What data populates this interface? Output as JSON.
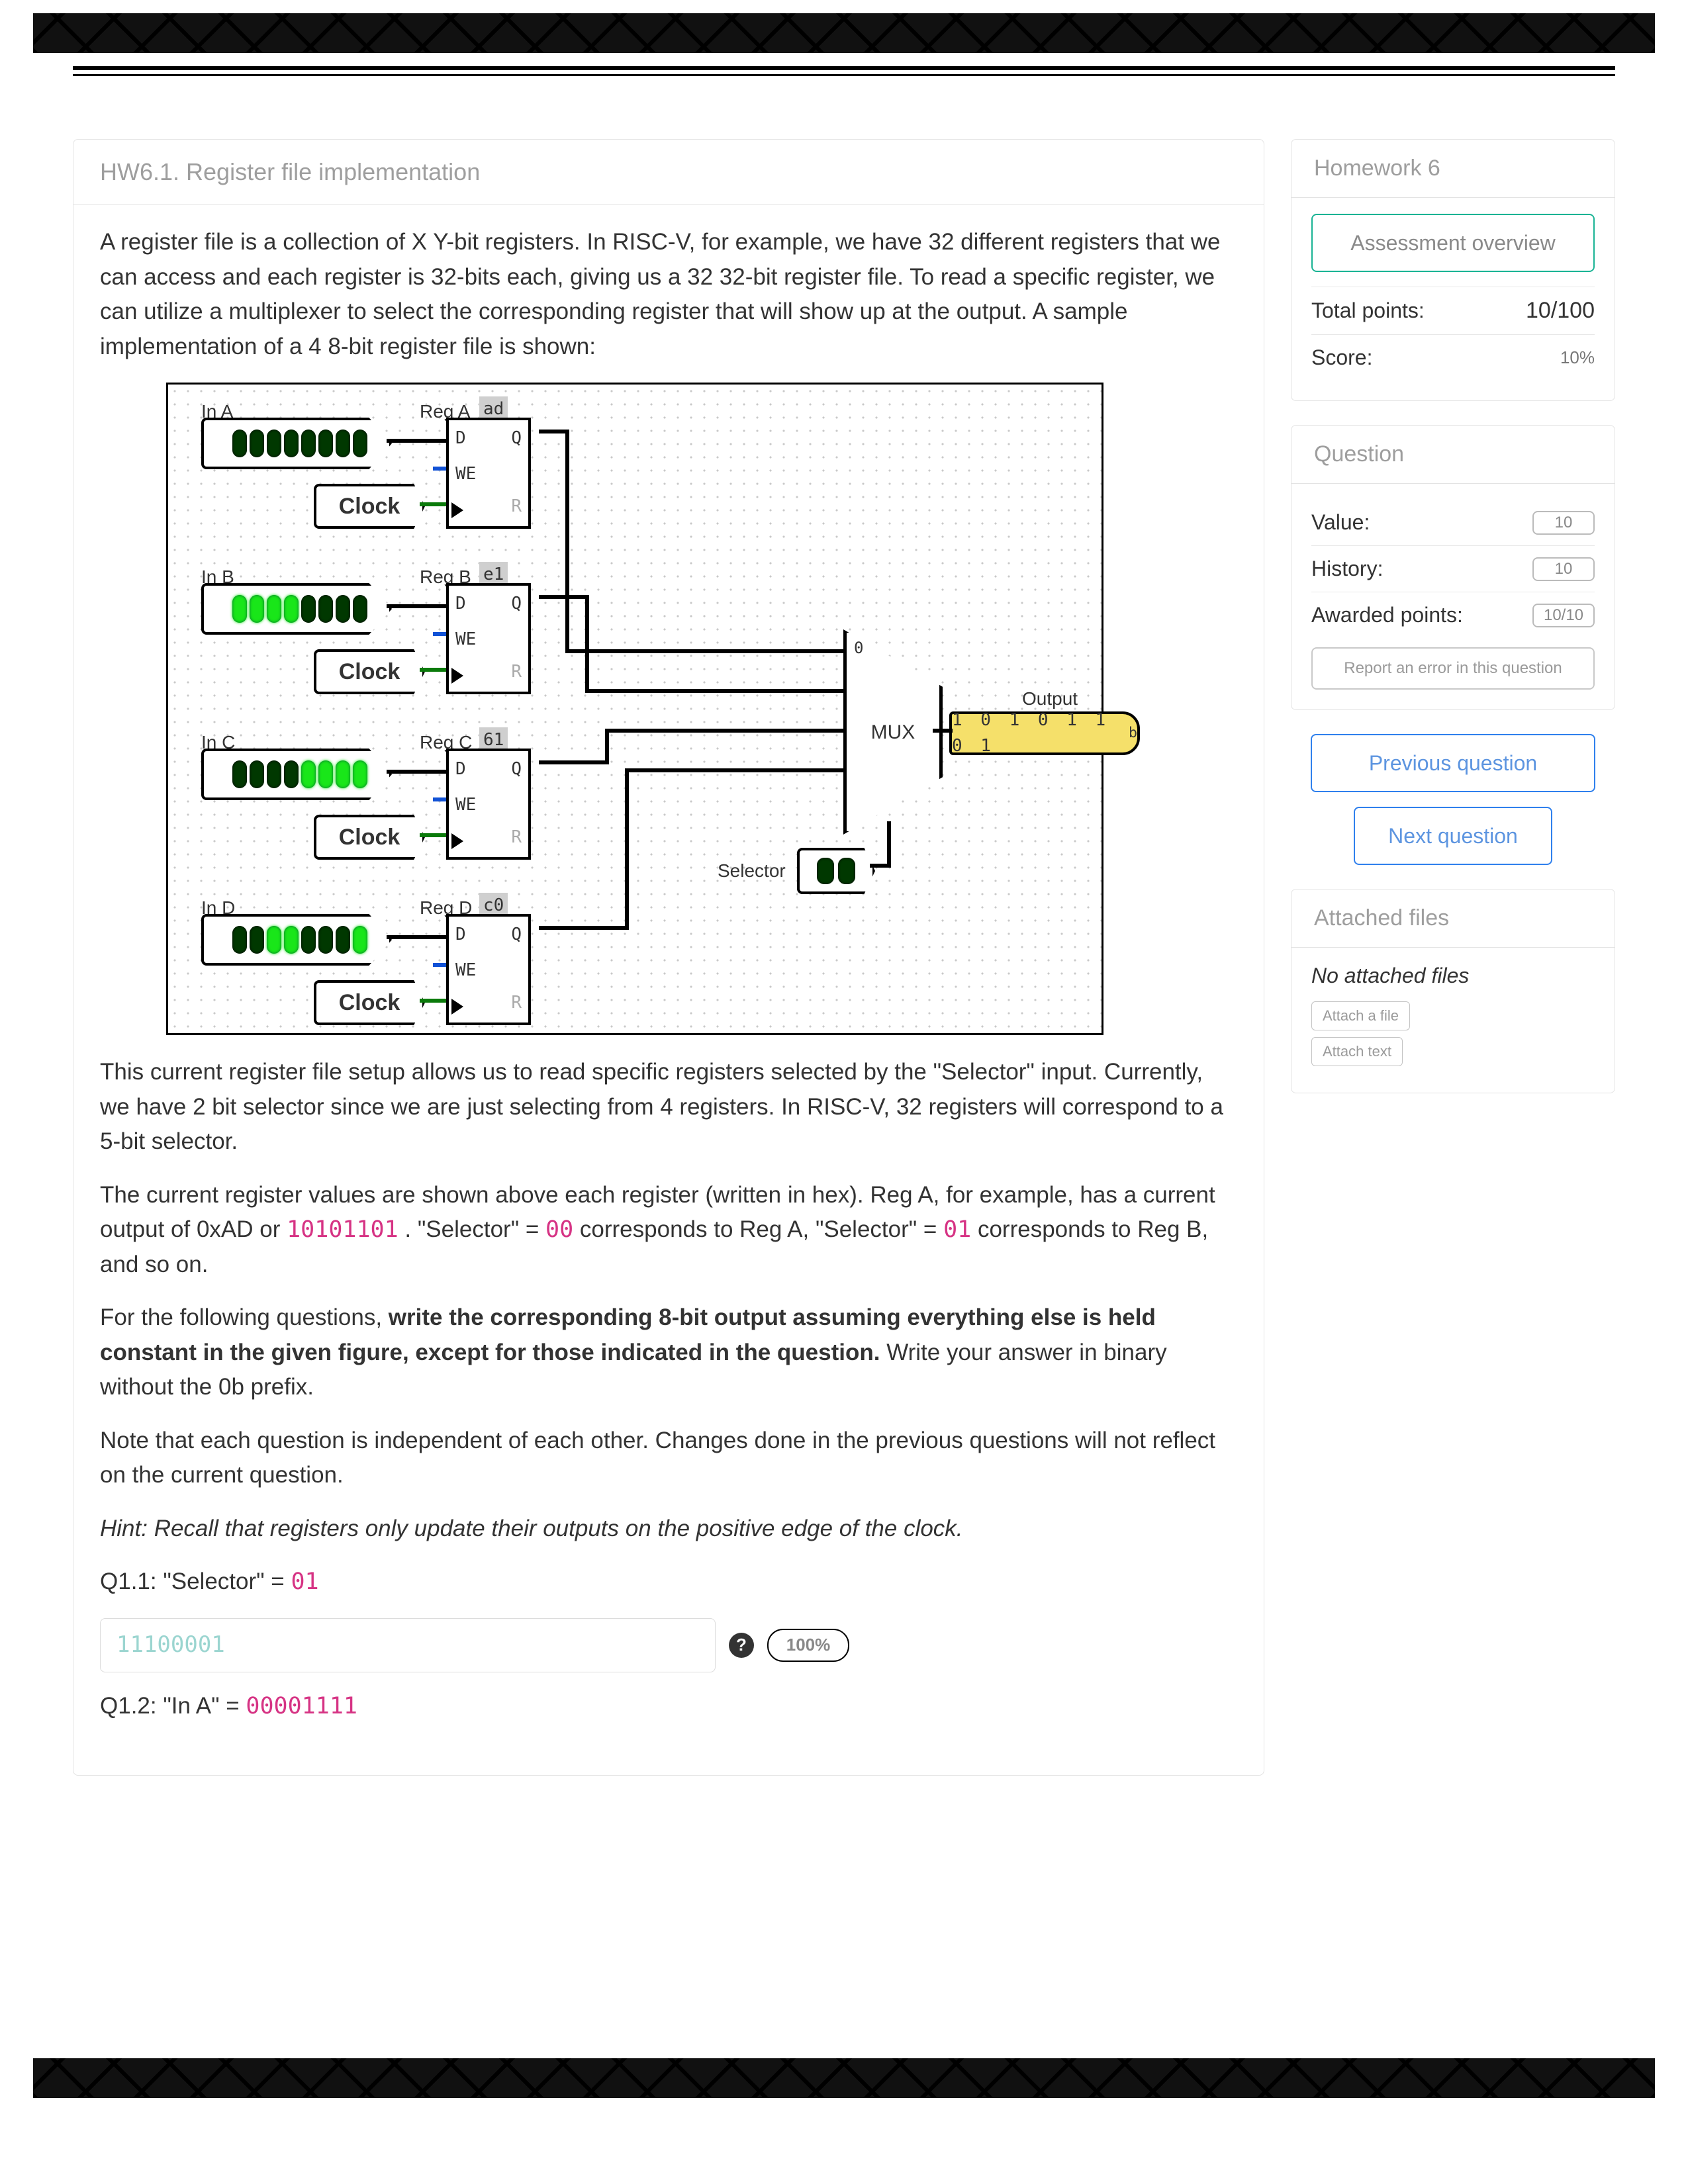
{
  "question": {
    "id_title": "HW6.1. Register file implementation",
    "intro": "A register file is a collection of X Y-bit registers. In RISC-V, for example, we have 32 different registers that we can access and each register is 32-bits each, giving us a 32 32-bit register file. To read a specific register, we can utilize a multiplexer to select the corresponding register that will show up at the output. A sample implementation of a 4 8-bit register file is shown:",
    "after_fig_1": "This current register file setup allows us to read specific registers selected by the \"Selector\" input. Currently, we have 2 bit selector since we are just selecting from 4 registers. In RISC-V, 32 registers will correspond to a 5-bit selector.",
    "after_fig_2_prefix": "The current register values are shown above each register (written in hex). Reg A, for example, has a current output of 0xAD or ",
    "after_fig_2_m1": "10101101",
    "after_fig_2_mid": ". \"Selector\" = ",
    "after_fig_2_m2": "00",
    "after_fig_2_mid2": " corresponds to Reg A, \"Selector\" = ",
    "after_fig_2_m3": "01",
    "after_fig_2_end": " corresponds to Reg B, and so on.",
    "task_prefix": "For the following questions, ",
    "task_bold": "write the corresponding 8-bit output assuming everything else is held constant in the given figure, except for those indicated in the question.",
    "task_suffix": " Write your answer in binary without the 0b prefix.",
    "independent_note": "Note that each question is independent of each other. Changes done in the previous questions will not reflect on the current question.",
    "hint": "Hint: Recall that registers only update their outputs on the positive edge of the clock.",
    "q11_label": "Q1.1: \"Selector\" = ",
    "q11_val": "01",
    "q11_answer_placeholder": "11100001",
    "q11_percent": "100%",
    "q12_label": "Q1.2: \"In A\" = ",
    "q12_val": "00001111"
  },
  "diagram": {
    "clock_label": "Clock",
    "mux_label": "MUX",
    "mux_top_label": "0",
    "selector_label": "Selector",
    "selector_bits": [
      0,
      0
    ],
    "output_label": "Output",
    "output_bits": "1 0 1 0 1 1 0 1",
    "output_bits_sub": "b",
    "reg_pins": {
      "D": "D",
      "Q": "Q",
      "WE": "WE",
      "R": "R"
    },
    "rows": [
      {
        "in_label": "In A",
        "reg_label": "Reg A",
        "hex": "ad",
        "bits": [
          0,
          0,
          0,
          0,
          0,
          0,
          0,
          0
        ]
      },
      {
        "in_label": "In B",
        "reg_label": "Reg B",
        "hex": "e1",
        "bits": [
          1,
          1,
          1,
          1,
          0,
          0,
          0,
          0
        ]
      },
      {
        "in_label": "In C",
        "reg_label": "Reg C",
        "hex": "61",
        "bits": [
          0,
          0,
          0,
          0,
          1,
          1,
          1,
          1
        ]
      },
      {
        "in_label": "In D",
        "reg_label": "Reg D",
        "hex": "c0",
        "bits": [
          0,
          0,
          1,
          1,
          0,
          0,
          0,
          1
        ]
      }
    ]
  },
  "sidebar": {
    "hw_title": "Homework 6",
    "assessment_btn": "Assessment overview",
    "total_points_label": "Total points:",
    "total_points_value": "10/100",
    "score_label": "Score:",
    "score_value": "10%",
    "question_header": "Question",
    "value_label": "Value:",
    "value_pill": "10",
    "history_label": "History:",
    "history_pill": "10",
    "awarded_label": "Awarded points:",
    "awarded_pill": "10/10",
    "report_label": "Report an error in this question",
    "prev_label": "Previous question",
    "next_label": "Next question",
    "attached_header": "Attached files",
    "no_files": "No attached files",
    "attach_file": "Attach a file",
    "attach_text": "Attach text"
  }
}
